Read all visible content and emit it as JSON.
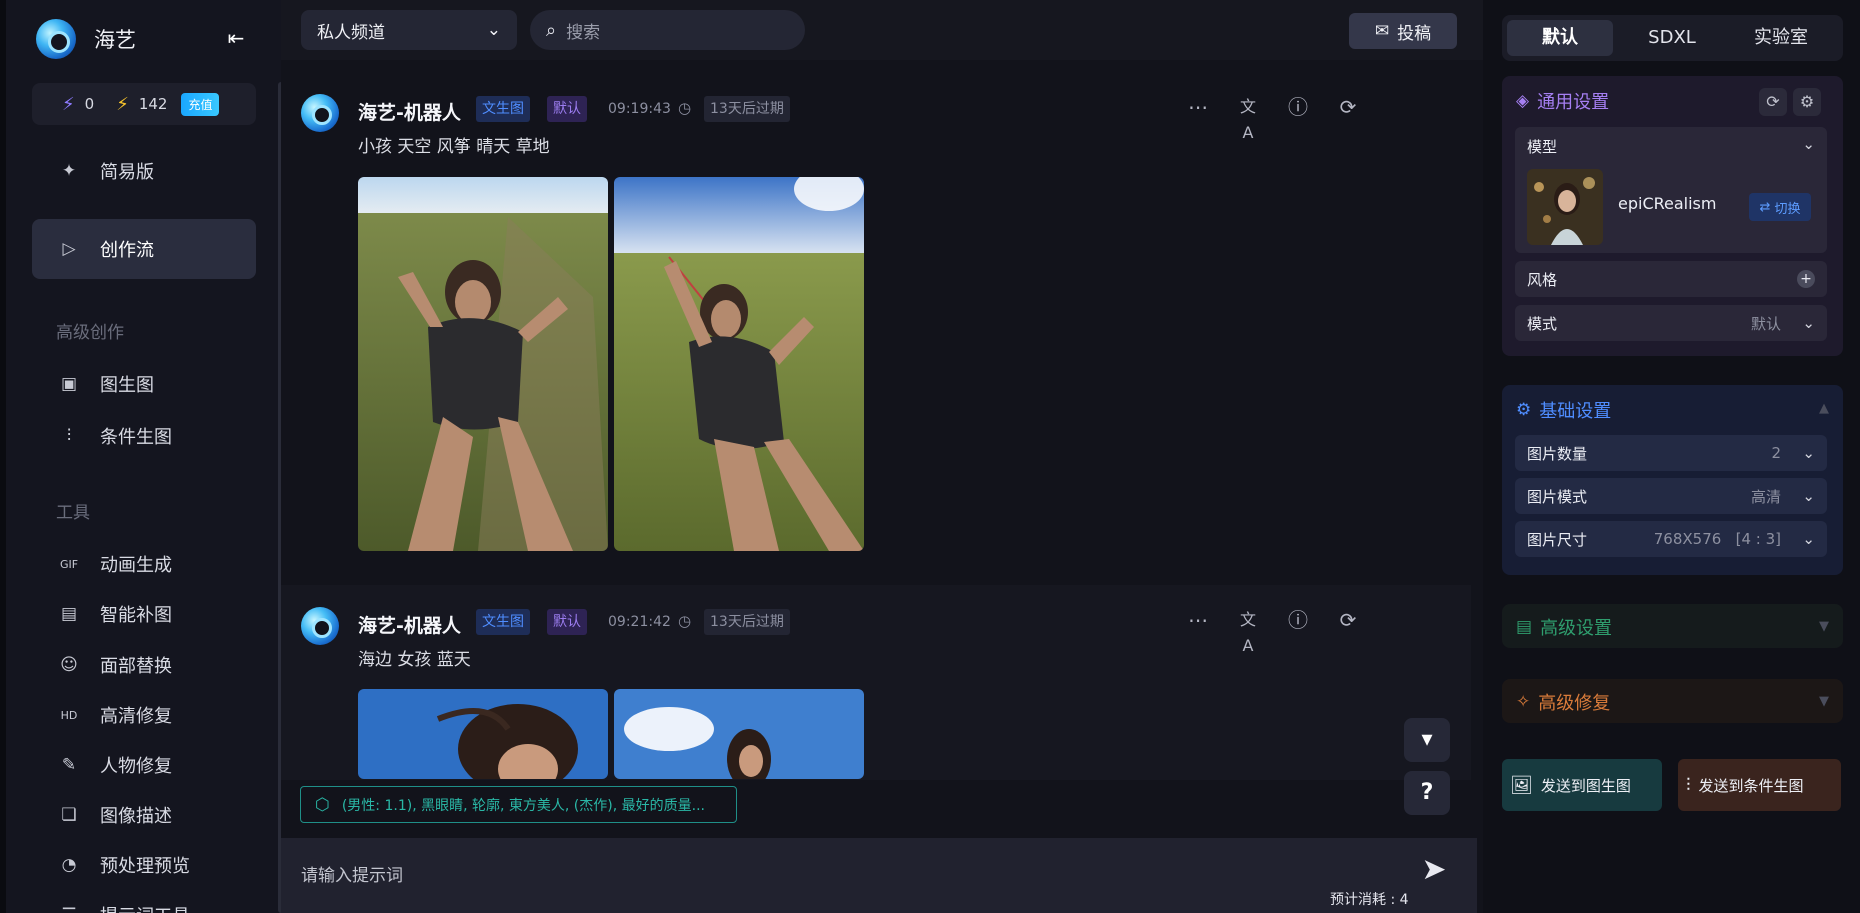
{
  "app": {
    "brand": "海艺",
    "stats": {
      "energy": "0",
      "lightning": "142",
      "recharge": "充值"
    }
  },
  "sidebar": {
    "simple": "简易版",
    "flow": "创作流",
    "section_advanced": "高级创作",
    "img2img": "图生图",
    "controlnet": "条件生图",
    "section_tools": "工具",
    "animation": "动画生成",
    "inpaint": "智能补图",
    "faceswap": "面部替换",
    "hd": "高清修复",
    "person_fix": "人物修复",
    "describe": "图像描述",
    "preprocess": "预处理预览",
    "prompt_tool": "提示词工具"
  },
  "topbar": {
    "channel": "私人频道",
    "search_placeholder": "搜索",
    "submit": "投稿"
  },
  "messages": [
    {
      "name": "海艺-机器人",
      "tag1": "文生图",
      "tag2": "默认",
      "time": "09:19:43",
      "expire": "13天后过期",
      "prompt": "小孩 天空 风筝 晴天 草地"
    },
    {
      "name": "海艺-机器人",
      "tag1": "文生图",
      "tag2": "默认",
      "time": "09:21:42",
      "expire": "13天后过期",
      "prompt": "海边 女孩 蓝天"
    }
  ],
  "hint_chip": "(男性: 1.1), 黑眼睛, 轮廓, 東方美人, (杰作), 最好的质量...",
  "input": {
    "placeholder": "请输入提示词",
    "cost": "预计消耗 : 4"
  },
  "right": {
    "tabs": [
      "默认",
      "SDXL",
      "实验室"
    ],
    "general": {
      "title": "通用设置",
      "model_label": "模型",
      "model_name": "epiCRealism",
      "switch": "切换",
      "style_label": "风格",
      "mode_label": "模式",
      "mode_value": "默认"
    },
    "basic": {
      "title": "基础设置",
      "count_label": "图片数量",
      "count_value": "2",
      "quality_label": "图片模式",
      "quality_value": "高清",
      "size_label": "图片尺寸",
      "size_value": "768X576   [4 : 3]"
    },
    "advanced": {
      "title": "高级设置"
    },
    "repair": {
      "title": "高级修复"
    },
    "send_img2img": "发送到图生图",
    "send_controlnet": "发送到条件生图"
  },
  "colors": {
    "accent_blue": "#4f8dff",
    "accent_purple": "#a57ff2",
    "teal": "#2ab7a6",
    "recharge": "#1aa7ff"
  },
  "icons": [
    "collapse-left-icon",
    "energy-icon",
    "lightning-icon",
    "sparkle-icon",
    "play-icon",
    "image-icon",
    "sliders-icon",
    "gif-icon",
    "inpaint-icon",
    "face-icon",
    "hd-icon",
    "wrench-icon",
    "book-icon",
    "preview-icon",
    "search-icon",
    "chevron-down-icon",
    "submit-icon",
    "more-icon",
    "translate-icon",
    "alert-icon",
    "refresh-icon",
    "timer-icon",
    "cube-icon",
    "send-icon",
    "question-icon",
    "gear-icon"
  ]
}
